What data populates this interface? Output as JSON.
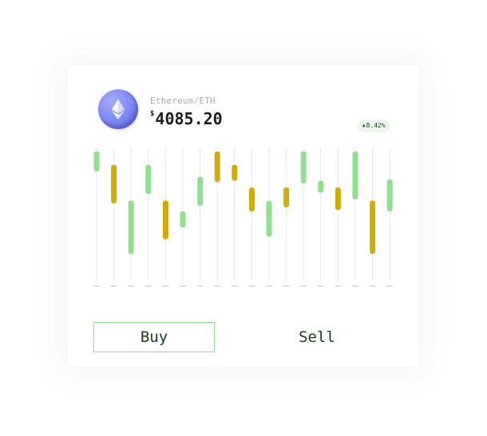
{
  "asset": {
    "pair": "Ethereum/ETH",
    "currency_symbol": "$",
    "price": "4085.20",
    "change": "8.42%",
    "change_direction": "up",
    "icon": "ethereum-icon"
  },
  "actions": {
    "buy_label": "Buy",
    "sell_label": "Sell"
  },
  "colors": {
    "up": "#8fe08f",
    "down": "#d1ab0a",
    "coin": "#7c86f4",
    "text": "#154416"
  },
  "chart_data": {
    "type": "candlestick",
    "title": "",
    "xlabel": "",
    "ylabel": "",
    "ylim": [
      0,
      100
    ],
    "grid": true,
    "candles": [
      {
        "open": 82,
        "close": 97,
        "dir": "up"
      },
      {
        "open": 87,
        "close": 58,
        "dir": "down"
      },
      {
        "open": 20,
        "close": 60,
        "dir": "up"
      },
      {
        "open": 65,
        "close": 87,
        "dir": "up"
      },
      {
        "open": 60,
        "close": 31,
        "dir": "down"
      },
      {
        "open": 40,
        "close": 52,
        "dir": "up"
      },
      {
        "open": 56,
        "close": 78,
        "dir": "up"
      },
      {
        "open": 97,
        "close": 74,
        "dir": "down"
      },
      {
        "open": 87,
        "close": 75,
        "dir": "down"
      },
      {
        "open": 70,
        "close": 52,
        "dir": "down"
      },
      {
        "open": 33,
        "close": 60,
        "dir": "up"
      },
      {
        "open": 70,
        "close": 55,
        "dir": "down"
      },
      {
        "open": 73,
        "close": 97,
        "dir": "up"
      },
      {
        "open": 66,
        "close": 75,
        "dir": "up"
      },
      {
        "open": 70,
        "close": 53,
        "dir": "down"
      },
      {
        "open": 61,
        "close": 97,
        "dir": "up"
      },
      {
        "open": 60,
        "close": 20,
        "dir": "down"
      },
      {
        "open": 52,
        "close": 76,
        "dir": "up"
      }
    ]
  }
}
